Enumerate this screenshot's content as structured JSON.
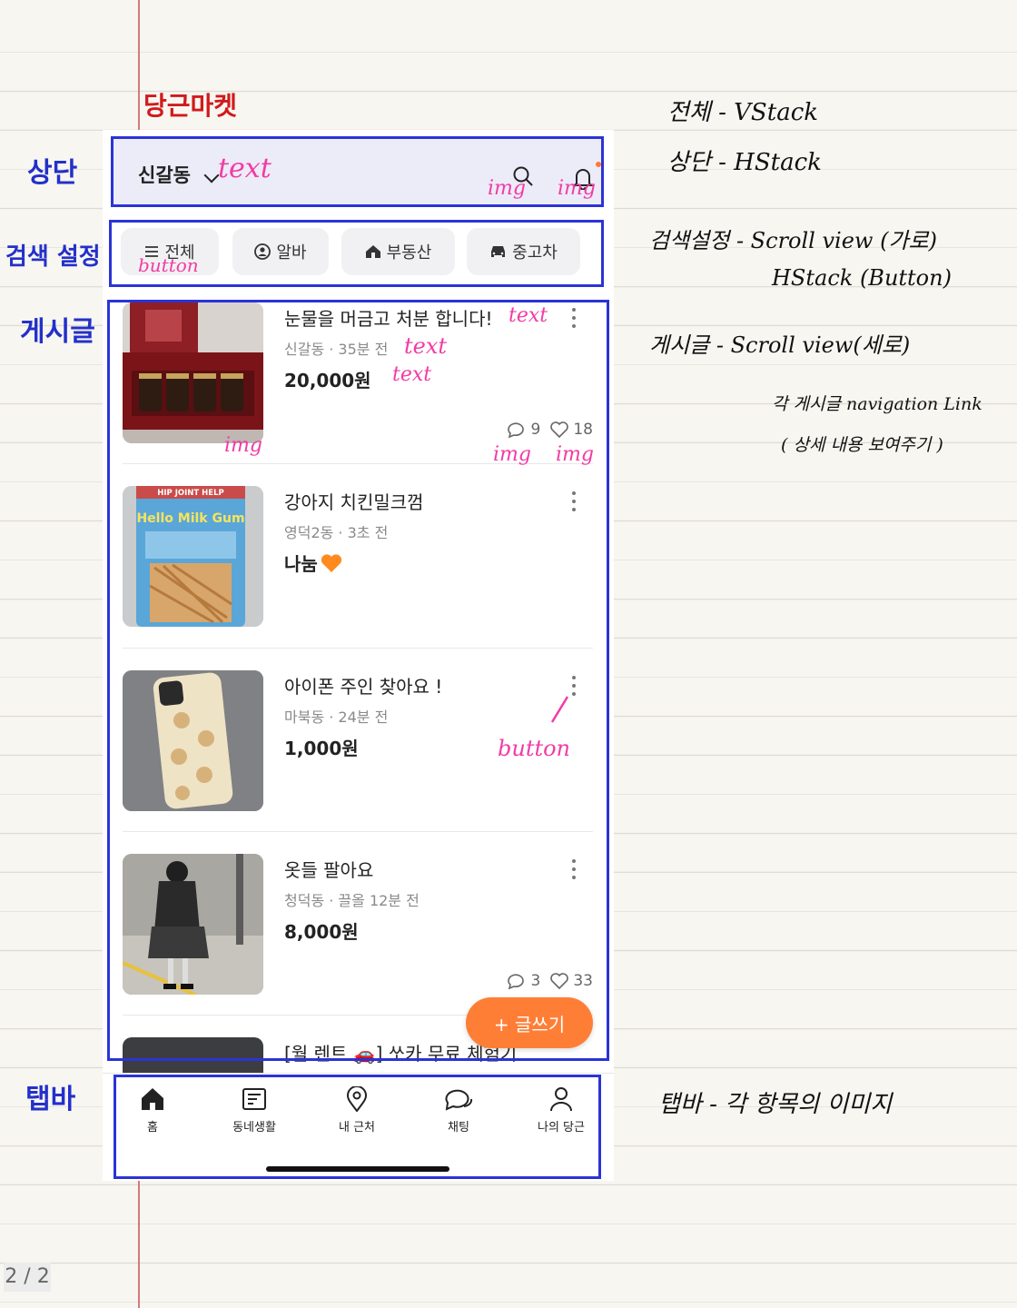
{
  "app_title": "당근마켓",
  "header": {
    "location": "신갈동"
  },
  "categories": [
    {
      "label": "전체",
      "icon": "menu-icon"
    },
    {
      "label": "알바",
      "icon": "person-icon"
    },
    {
      "label": "부동산",
      "icon": "house-icon"
    },
    {
      "label": "중고차",
      "icon": "car-icon"
    }
  ],
  "posts": [
    {
      "title": "눈물을 머금고 처분 합니다!",
      "meta": "신갈동 · 35분 전",
      "price": "20,000원",
      "comments": "9",
      "likes": "18"
    },
    {
      "title": "강아지 치킨밀크껌",
      "meta": "영덕2동 · 3초 전",
      "price": "나눔"
    },
    {
      "title": "아이폰 주인 찾아요 !",
      "meta": "마북동 · 24분 전",
      "price": "1,000원"
    },
    {
      "title": "옷들 팔아요",
      "meta": "청덕동 · 끌올 12분 전",
      "price": "8,000원",
      "comments": "3",
      "likes": "33"
    },
    {
      "title": "[월 렌트 🚗] 쏘카 무료 체험기"
    }
  ],
  "image_text": {
    "milkgum_banner": "HIP JOINT HELP",
    "milkgum_brand": "Hello Milk Gum"
  },
  "fab_label": "+ 글쓰기",
  "tabs": [
    {
      "label": "홈",
      "icon": "home-icon"
    },
    {
      "label": "동네생활",
      "icon": "board-icon"
    },
    {
      "label": "내 근처",
      "icon": "location-pin-icon"
    },
    {
      "label": "채팅",
      "icon": "chat-icon"
    },
    {
      "label": "나의 당근",
      "icon": "user-icon"
    }
  ],
  "annotations": {
    "left": {
      "top": "상단",
      "search": "검색 설정",
      "posts": "게시글",
      "tabbar": "탭바"
    },
    "inline": {
      "text": "text",
      "img": "img",
      "button": "button"
    },
    "notes": {
      "line1": "전체 - VStack",
      "line2": "상단 - HStack",
      "line3a": "검색설정 - Scroll view (가로)",
      "line3b": "HStack (Button)",
      "line4": "게시글 - Scroll view(세로)",
      "line5a": "각 게시글 navigation Link",
      "line5b": "( 상세 내용 보여주기 )",
      "line6": "탭바 - 각 항목의 이미지"
    }
  },
  "page_number": "2 / 2",
  "colors": {
    "brand_orange": "#ff7e36",
    "annotation_blue": "#2b33d6",
    "annotation_pink": "#f23ba5",
    "margin_red": "#d7777c"
  }
}
